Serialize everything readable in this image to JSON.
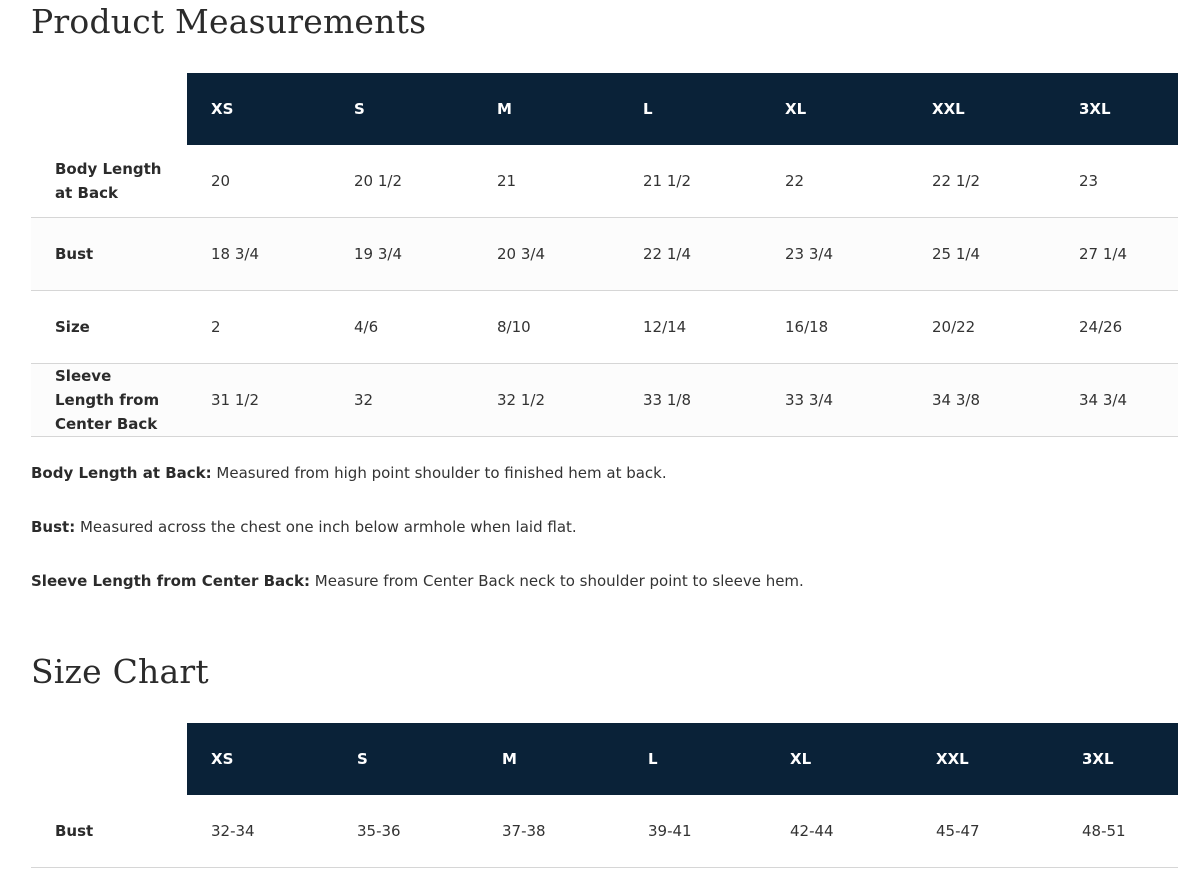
{
  "measurements": {
    "title": "Product Measurements",
    "sizes": [
      "XS",
      "S",
      "M",
      "L",
      "XL",
      "XXL",
      "3XL"
    ],
    "rows": [
      {
        "label": "Body Length at Back",
        "values": [
          "20",
          "20 1/2",
          "21",
          "21 1/2",
          "22",
          "22 1/2",
          "23"
        ]
      },
      {
        "label": "Bust",
        "values": [
          "18 3/4",
          "19 3/4",
          "20 3/4",
          "22 1/4",
          "23 3/4",
          "25 1/4",
          "27 1/4"
        ]
      },
      {
        "label": "Size",
        "values": [
          "2",
          "4/6",
          "8/10",
          "12/14",
          "16/18",
          "20/22",
          "24/26"
        ]
      },
      {
        "label": "Sleeve Length from Center Back",
        "values": [
          "31 1/2",
          "32",
          "32 1/2",
          "33 1/8",
          "33 3/4",
          "34 3/8",
          "34 3/4"
        ]
      }
    ],
    "notes": [
      {
        "term": "Body Length at Back:",
        "text": " Measured from high point shoulder to finished hem at back."
      },
      {
        "term": "Bust:",
        "text": " Measured across the chest one inch below armhole when laid flat."
      },
      {
        "term": "Sleeve Length from Center Back:",
        "text": " Measure from Center Back neck to shoulder point to sleeve hem."
      }
    ]
  },
  "size_chart": {
    "title": "Size Chart",
    "sizes": [
      "XS",
      "S",
      "M",
      "L",
      "XL",
      "XXL",
      "3XL"
    ],
    "rows": [
      {
        "label": "Bust",
        "values": [
          "32-34",
          "35-36",
          "37-38",
          "39-41",
          "42-44",
          "45-47",
          "48-51"
        ]
      }
    ]
  },
  "colors": {
    "header_bg": "#0a2238",
    "header_text": "#ffffff",
    "row_border": "#d6d6d6",
    "body_text": "#333333"
  }
}
